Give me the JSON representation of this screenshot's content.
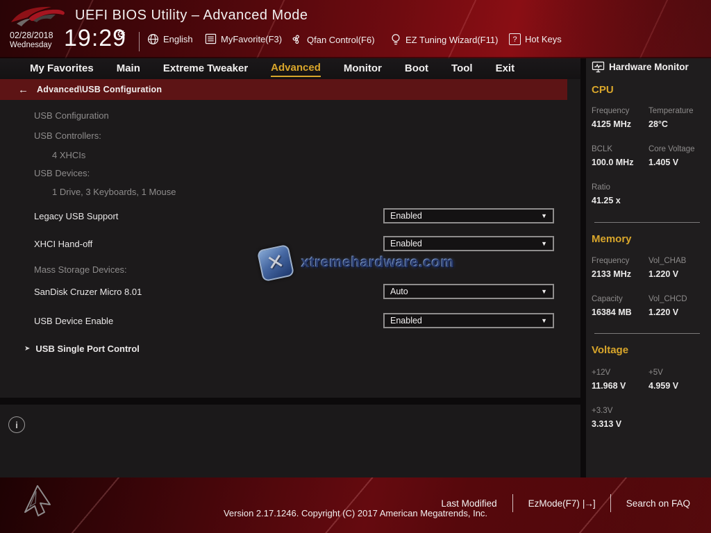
{
  "header": {
    "title": "UEFI BIOS Utility – Advanced Mode",
    "date": "02/28/2018",
    "weekday": "Wednesday",
    "time": "19:29",
    "language_label": "English",
    "shortcuts": [
      {
        "label": "MyFavorite(F3)"
      },
      {
        "label": "Qfan Control(F6)"
      },
      {
        "label": "EZ Tuning Wizard(F11)"
      },
      {
        "label": "Hot Keys"
      }
    ]
  },
  "nav": {
    "tabs": [
      {
        "label": "My Favorites",
        "active": false
      },
      {
        "label": "Main",
        "active": false
      },
      {
        "label": "Extreme Tweaker",
        "active": false
      },
      {
        "label": "Advanced",
        "active": true
      },
      {
        "label": "Monitor",
        "active": false
      },
      {
        "label": "Boot",
        "active": false
      },
      {
        "label": "Tool",
        "active": false
      },
      {
        "label": "Exit",
        "active": false
      }
    ]
  },
  "breadcrumb": {
    "path": "Advanced\\USB Configuration"
  },
  "main": {
    "section_title": "USB Configuration",
    "info": [
      {
        "label": "USB Controllers:"
      },
      {
        "label": "4 XHCIs"
      },
      {
        "label": "USB Devices:"
      },
      {
        "label": "1 Drive, 3 Keyboards, 1 Mouse"
      }
    ],
    "settings": [
      {
        "label": "Legacy USB Support",
        "value": "Enabled"
      },
      {
        "label": "XHCI Hand-off",
        "value": "Enabled"
      },
      {
        "label": "SanDisk Cruzer Micro 8.01",
        "value": "Auto"
      },
      {
        "label": "USB Device Enable",
        "value": "Enabled"
      }
    ],
    "group_label": "Mass Storage Devices:",
    "submenu": {
      "label": "USB Single Port Control"
    }
  },
  "watermark": {
    "text": "xtremehardware.com",
    "x_glyph": "✕"
  },
  "hardware_monitor": {
    "title": "Hardware Monitor",
    "cpu": {
      "name": "CPU",
      "pairs": [
        {
          "label": "Frequency",
          "value": "4125 MHz"
        },
        {
          "label": "Temperature",
          "value": "28°C"
        },
        {
          "label": "BCLK",
          "value": "100.0 MHz"
        },
        {
          "label": "Core Voltage",
          "value": "1.405 V"
        },
        {
          "label": "Ratio",
          "value": "41.25 x"
        }
      ]
    },
    "memory": {
      "name": "Memory",
      "pairs": [
        {
          "label": "Frequency",
          "value": "2133 MHz"
        },
        {
          "label": "Vol_CHAB",
          "value": "1.220 V"
        },
        {
          "label": "Capacity",
          "value": "16384 MB"
        },
        {
          "label": "Vol_CHCD",
          "value": "1.220 V"
        }
      ]
    },
    "voltage": {
      "name": "Voltage",
      "pairs": [
        {
          "label": "+12V",
          "value": "11.968 V"
        },
        {
          "label": "+5V",
          "value": "4.959 V"
        },
        {
          "label": "+3.3V",
          "value": "3.313 V"
        }
      ]
    }
  },
  "footer": {
    "items": [
      {
        "label": "Last Modified"
      },
      {
        "label": "EzMode(F7)"
      },
      {
        "label": "Search on FAQ"
      }
    ],
    "version": "Version 2.17.1246. Copyright (C) 2017 American Megatrends, Inc."
  },
  "icons": {
    "gear": "⚙",
    "question": "?",
    "back_arrow": "←",
    "chevron_down": "▼",
    "submenu_arrow": "➤",
    "info": "i",
    "ezmode": "|→]"
  },
  "colors": {
    "accent_gold": "#d9a62b",
    "breadcrumb_red": "#5d1415",
    "header_red": "#6e0b10",
    "panel_dark": "#1c1a1b",
    "label_gray": "#8e8c8c",
    "value_white": "#e9e7e7"
  }
}
